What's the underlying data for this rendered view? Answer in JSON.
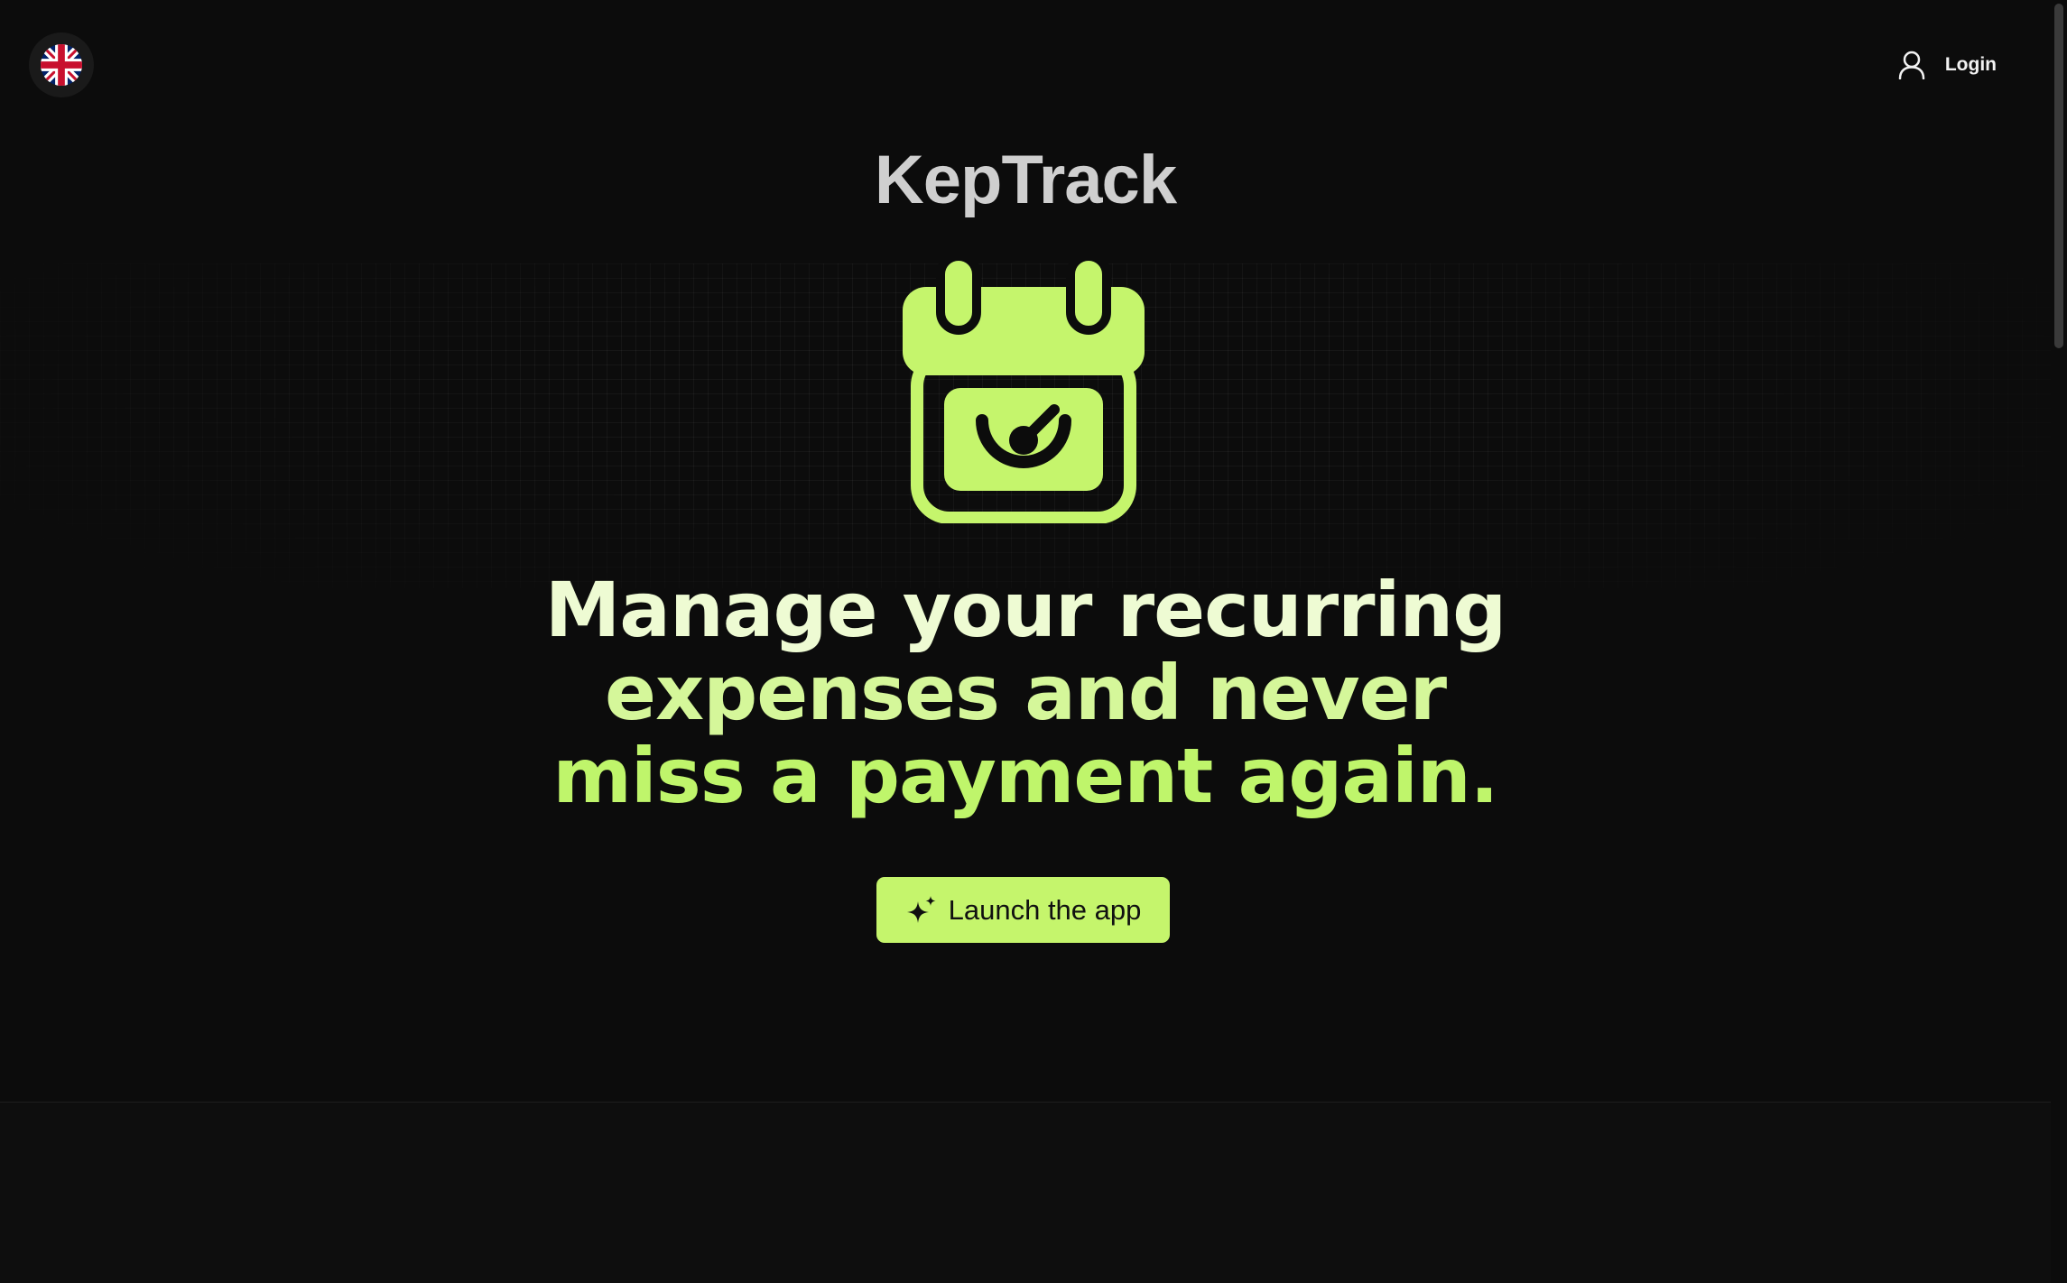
{
  "header": {
    "language_flag": "united-kingdom-flag-icon",
    "login_label": "Login"
  },
  "hero": {
    "brand_title": "KepTrack",
    "logo_icon": "calendar-gauge-icon",
    "headline_lines": [
      "Manage your recurring",
      "expenses and never",
      "miss a payment again."
    ],
    "cta_label": "Launch the app",
    "cta_icon": "sparkles-icon"
  },
  "colors": {
    "background": "#0c0c0c",
    "accent": "#c5f56c",
    "title_gray": "#cfcfcf"
  }
}
